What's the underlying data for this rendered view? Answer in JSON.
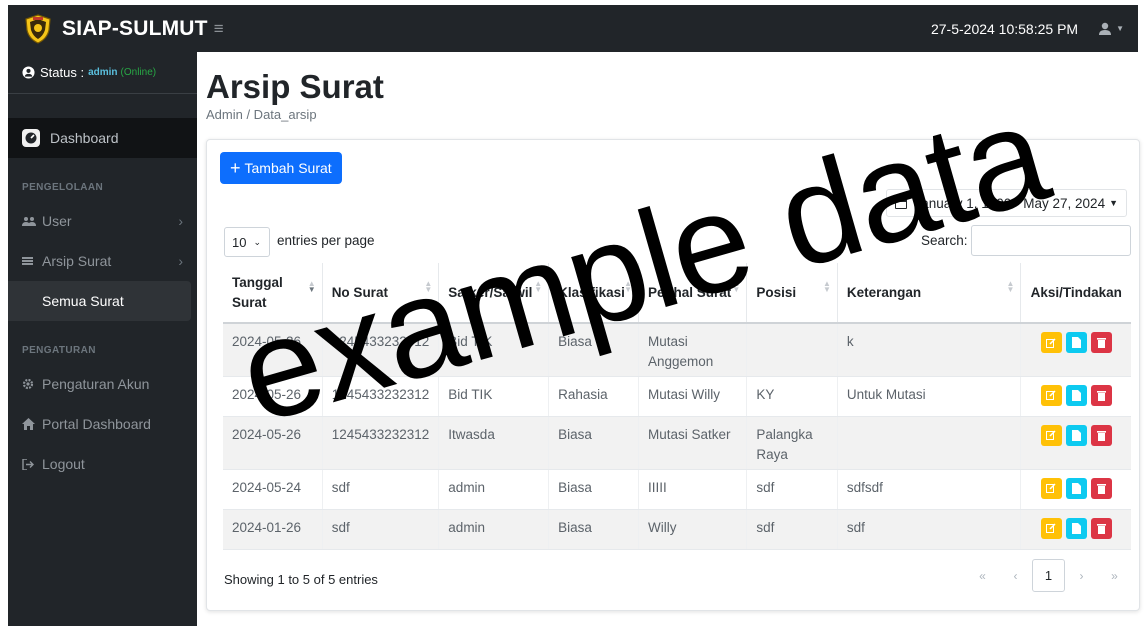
{
  "header": {
    "app_name": "SIAP-SULMUT",
    "datetime": "27-5-2024 10:58:25 PM",
    "menu_icon": "hamburger-icon",
    "user_icon": "user-icon"
  },
  "sidebar": {
    "status_label": "Status :",
    "status_role": "admin",
    "status_state": "(Online)",
    "dashboard_label": "Dashboard",
    "section_manage": "PENGELOLAAN",
    "user_label": "User",
    "arsip_label": "Arsip Surat",
    "semua_label": "Semua Surat",
    "section_settings": "PENGATURAN",
    "akun_label": "Pengaturan Akun",
    "portal_label": "Portal Dashboard",
    "logout_label": "Logout"
  },
  "page": {
    "title": "Arsip Surat",
    "breadcrumb": "Admin / Data_arsip"
  },
  "toolbar": {
    "add_label": "Tambah Surat",
    "date_range": "January 1, 1900 - May 27, 2024",
    "entries_value": "10",
    "entries_label": "entries per page",
    "search_label": "Search:",
    "search_value": ""
  },
  "table": {
    "headers": [
      "Tanggal Surat",
      "No Surat",
      "Satker/Satwil",
      "Klasifikasi",
      "Perihal Surat",
      "Posisi",
      "Keterangan",
      "Aksi/Tindakan"
    ],
    "rows": [
      [
        "2024-05-26",
        "1245433232312",
        "Bid TIK",
        "Biasa",
        "Mutasi Anggemon",
        "",
        "k",
        ""
      ],
      [
        "2024-05-26",
        "1245433232312",
        "Bid TIK",
        "Rahasia",
        "Mutasi Willy",
        "KY",
        "Untuk Mutasi",
        ""
      ],
      [
        "2024-05-26",
        "1245433232312",
        "Itwasda",
        "Biasa",
        "Mutasi Satker",
        "Palangka Raya",
        "",
        ""
      ],
      [
        "2024-05-24",
        "sdf",
        "admin",
        "Biasa",
        "IIIII",
        "sdf",
        "sdfsdf",
        ""
      ],
      [
        "2024-01-26",
        "sdf",
        "admin",
        "Biasa",
        "Willy",
        "sdf",
        "sdf",
        ""
      ]
    ]
  },
  "footer": {
    "info": "Showing 1 to 5 of 5 entries",
    "first": "«",
    "prev": "‹",
    "page": "1",
    "next": "›",
    "last": "»"
  },
  "watermark": "example data",
  "colors": {
    "navbar": "#212529",
    "primary": "#0d6efd",
    "edit": "#ffc107",
    "view": "#0dcaf0",
    "delete": "#dc3545"
  }
}
